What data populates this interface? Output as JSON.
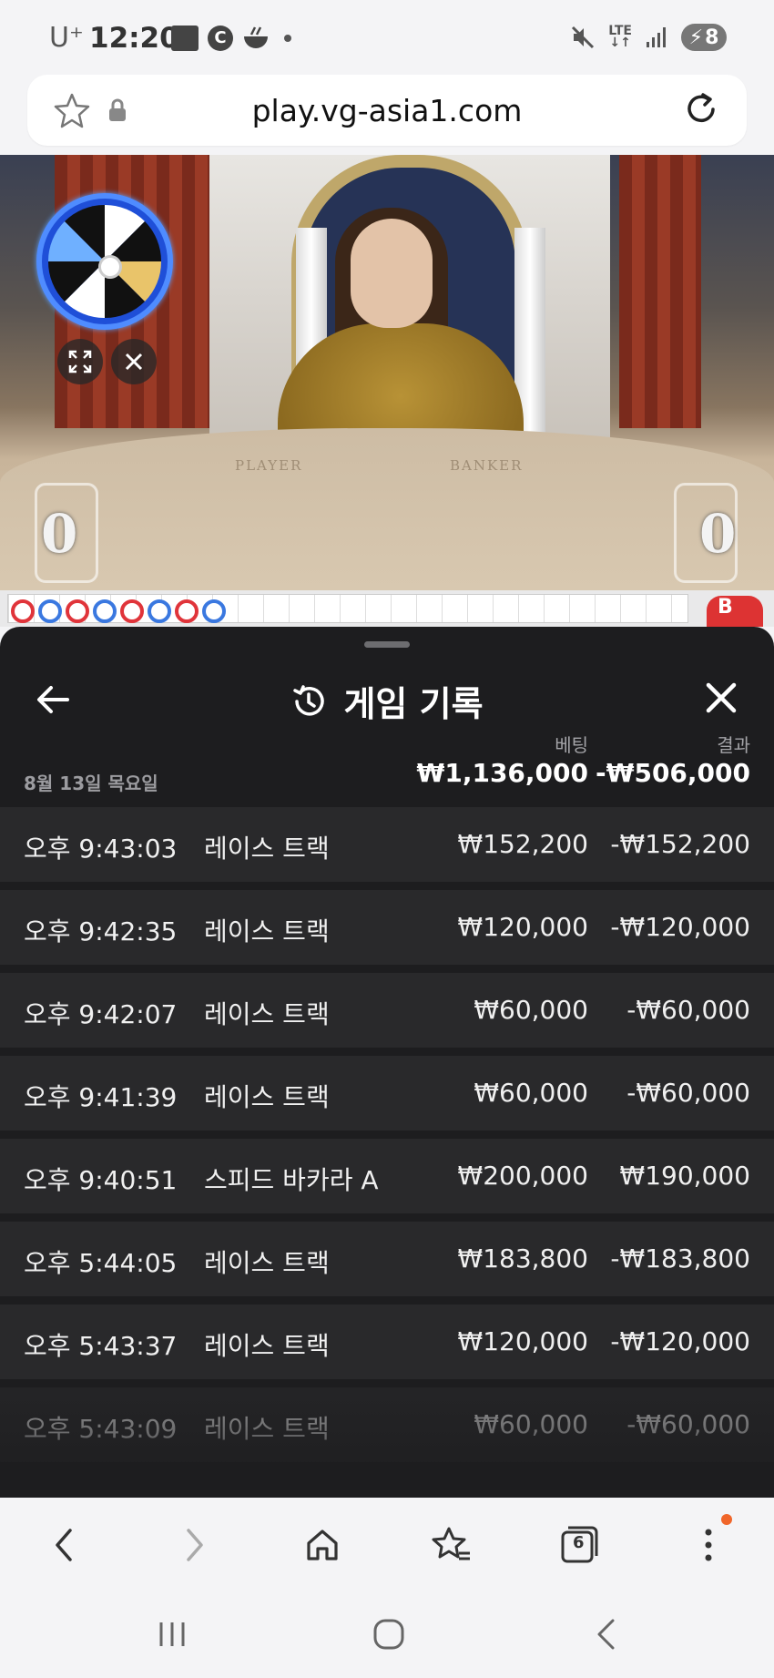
{
  "status_bar": {
    "carrier": "U⁺",
    "time": "12:20",
    "notif_letter": "C",
    "network": "LTE",
    "battery": "8"
  },
  "browser": {
    "url": "play.vg-asia1.com"
  },
  "video": {
    "felt_player": "PLAYER",
    "felt_banker": "BANKER",
    "player_score": "0",
    "banker_score": "0"
  },
  "road": {
    "marker": "B"
  },
  "history": {
    "title": "게임 기록",
    "col_bet": "베팅",
    "col_result": "결과",
    "date": "8월 13일 목요일",
    "total_bet": "₩1,136,000",
    "total_result": "-₩506,000",
    "rows": [
      {
        "time": "오후 9:43:03",
        "game": "레이스 트랙",
        "bet": "₩152,200",
        "result": "-₩152,200"
      },
      {
        "time": "오후 9:42:35",
        "game": "레이스 트랙",
        "bet": "₩120,000",
        "result": "-₩120,000"
      },
      {
        "time": "오후 9:42:07",
        "game": "레이스 트랙",
        "bet": "₩60,000",
        "result": "-₩60,000"
      },
      {
        "time": "오후 9:41:39",
        "game": "레이스 트랙",
        "bet": "₩60,000",
        "result": "-₩60,000"
      },
      {
        "time": "오후 9:40:51",
        "game": "스피드 바카라 A",
        "bet": "₩200,000",
        "result": "₩190,000"
      },
      {
        "time": "오후 5:44:05",
        "game": "레이스 트랙",
        "bet": "₩183,800",
        "result": "-₩183,800"
      },
      {
        "time": "오후 5:43:37",
        "game": "레이스 트랙",
        "bet": "₩120,000",
        "result": "-₩120,000"
      },
      {
        "time": "오후 5:43:09",
        "game": "레이스 트랙",
        "bet": "₩60,000",
        "result": "-₩60,000"
      }
    ]
  },
  "toolbar": {
    "tabs_count": "6"
  },
  "colors": {
    "sheet_bg": "#1d1d1f",
    "row_bg": "#29292b",
    "accent_notif": "#f0662a",
    "bead_red": "#e0343a",
    "bead_blue": "#3a78e0"
  }
}
